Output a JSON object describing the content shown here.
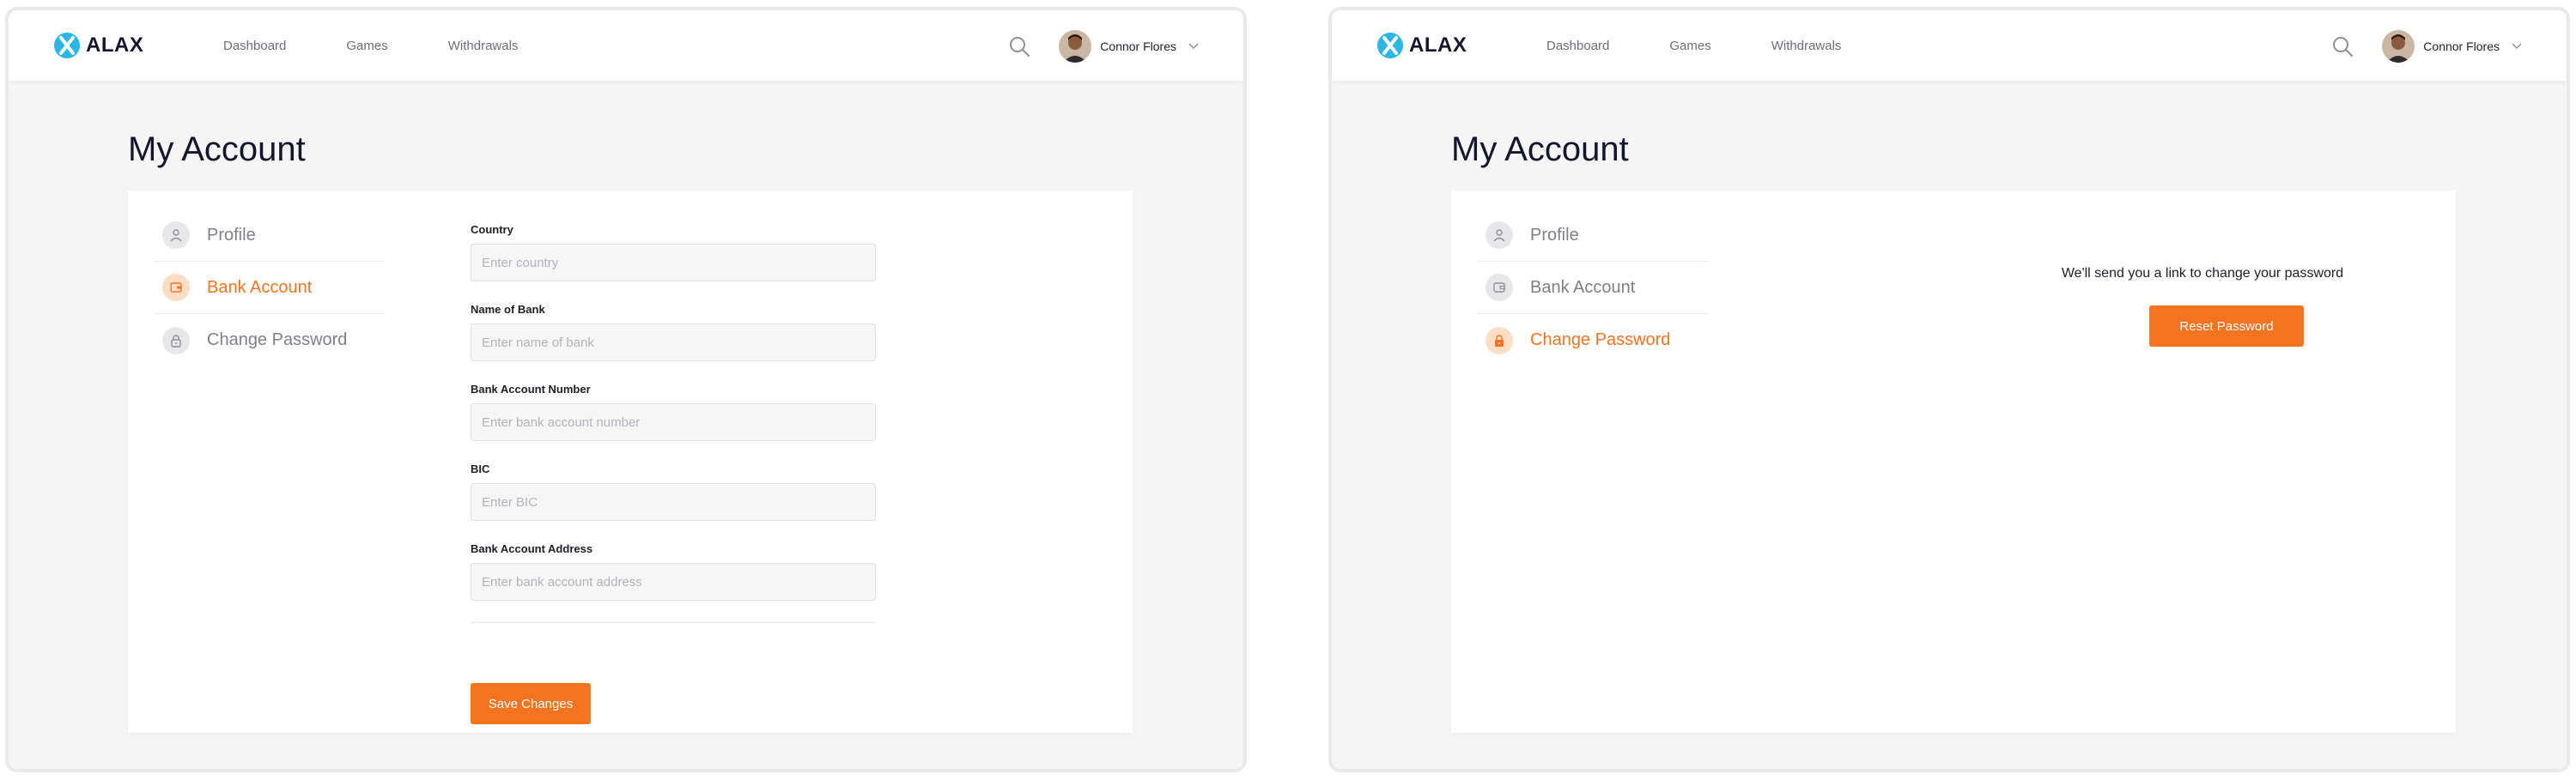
{
  "brand": {
    "name": "ALAX",
    "accent": "#f6731f",
    "logo_color": "#2bb7e6"
  },
  "nav": {
    "items": [
      "Dashboard",
      "Games",
      "Withdrawals"
    ]
  },
  "user": {
    "name": "Connor Flores"
  },
  "page": {
    "title": "My Account"
  },
  "menu": {
    "profile": "Profile",
    "bank_account": "Bank Account",
    "change_password": "Change Password"
  },
  "bank_form": {
    "fields": [
      {
        "label": "Country",
        "placeholder": "Enter country"
      },
      {
        "label": "Name of Bank",
        "placeholder": "Enter name of bank"
      },
      {
        "label": "Bank Account Number",
        "placeholder": "Enter bank account number"
      },
      {
        "label": "BIC",
        "placeholder": "Enter BIC"
      },
      {
        "label": "Bank Account Address",
        "placeholder": "Enter bank account address"
      }
    ],
    "save_label": "Save Changes"
  },
  "password_panel": {
    "message": "We'll send you a link to change your password",
    "reset_label": "Reset Password"
  },
  "icons": {
    "search": "search-icon",
    "chevron": "chevron-down-icon",
    "profile": "user-icon",
    "bank": "wallet-icon",
    "password": "lock-icon"
  }
}
